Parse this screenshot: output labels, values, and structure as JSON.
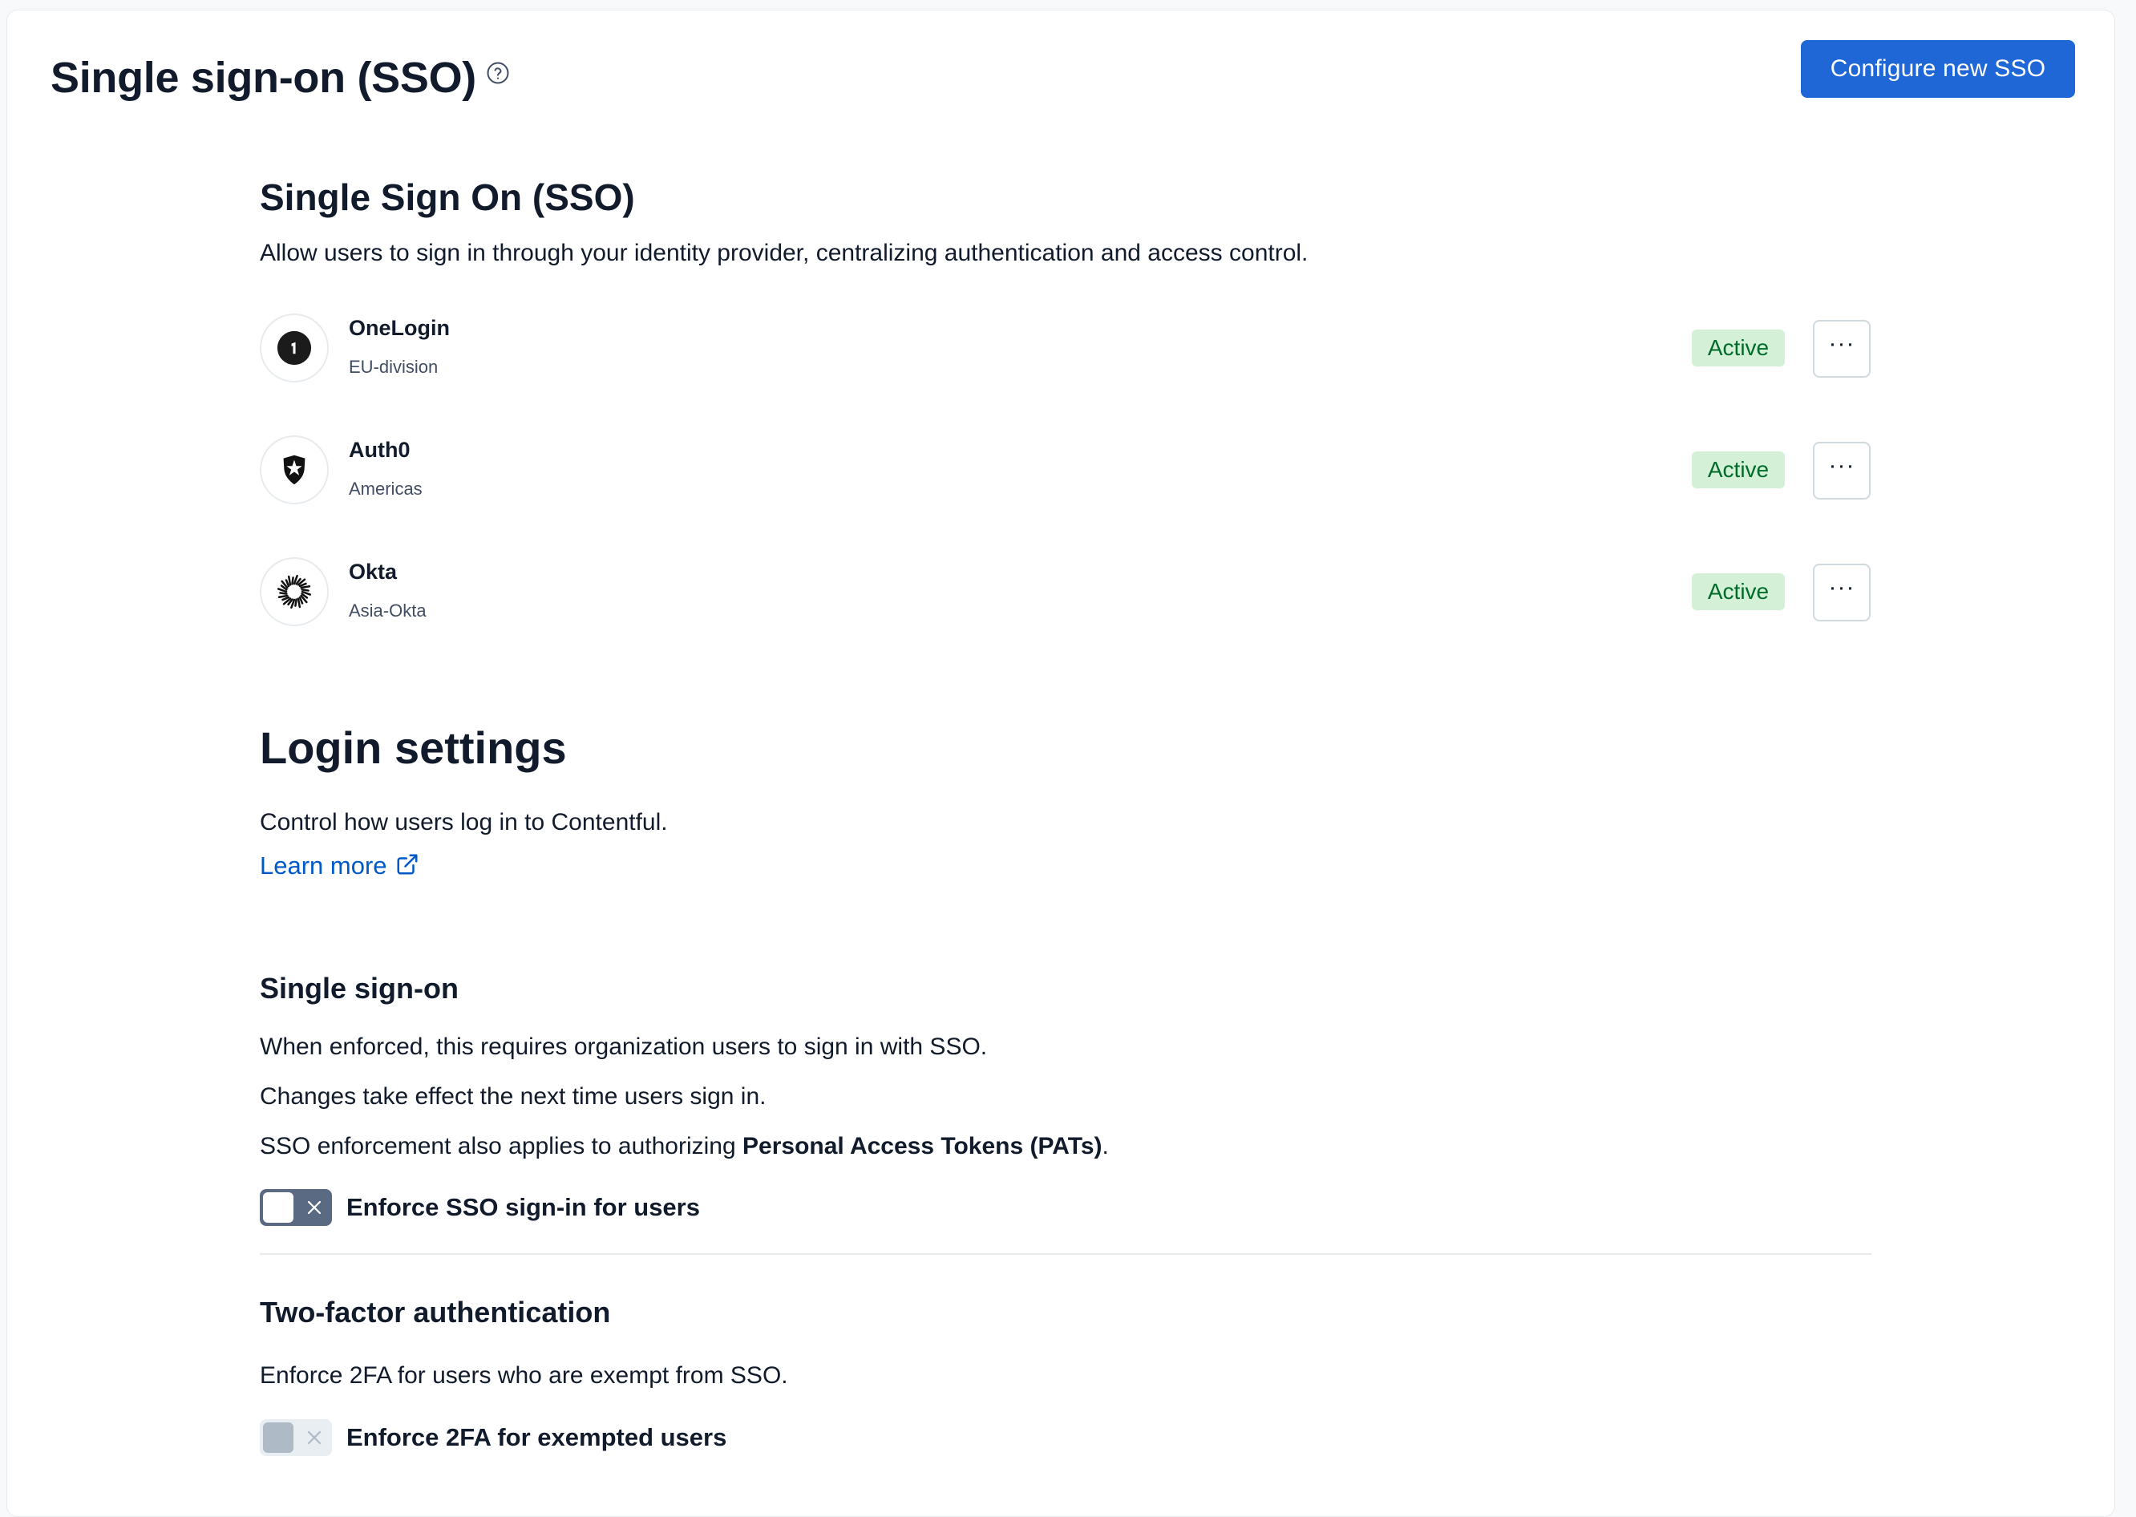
{
  "header": {
    "title": "Single sign-on (SSO)",
    "help_icon": "question-circle-icon",
    "configure_button_label": "Configure new SSO"
  },
  "sso": {
    "heading": "Single Sign On (SSO)",
    "description": "Allow users to sign in through your identity provider, centralizing authentication and access control.",
    "providers": [
      {
        "name": "OneLogin",
        "subtitle": "EU-division",
        "status": "Active",
        "logo_icon": "onelogin-logo-icon",
        "menu_icon": "more-horizontal-icon"
      },
      {
        "name": "Auth0",
        "subtitle": "Americas",
        "status": "Active",
        "logo_icon": "auth0-logo-icon",
        "menu_icon": "more-horizontal-icon"
      },
      {
        "name": "Okta",
        "subtitle": "Asia-Okta",
        "status": "Active",
        "logo_icon": "okta-logo-icon",
        "menu_icon": "more-horizontal-icon"
      }
    ],
    "more_label": "···"
  },
  "login_settings": {
    "heading": "Login settings",
    "description": "Control how users log in to Contentful.",
    "learn_more_label": "Learn more",
    "learn_more_icon": "external-link-icon"
  },
  "single_sign_on": {
    "heading": "Single sign-on",
    "line1": "When enforced, this requires organization users to sign in with SSO.",
    "line2": "Changes take effect the next time users sign in.",
    "line3_prefix": "SSO enforcement also applies to authorizing ",
    "line3_bold": "Personal Access Tokens (PATs)",
    "line3_suffix": ".",
    "toggle_label": "Enforce SSO sign-in for users",
    "toggle_on": false,
    "toggle_disabled": false
  },
  "two_factor": {
    "heading": "Two-factor authentication",
    "description": "Enforce 2FA for users who are exempt from SSO.",
    "toggle_label": "Enforce 2FA for exempted users",
    "toggle_on": false,
    "toggle_disabled": true
  },
  "colors": {
    "primary": "#1f67d6",
    "link": "#0059c8",
    "badge_bg": "#d4f1d7",
    "badge_text": "#006b2a",
    "text": "#111b2b"
  }
}
